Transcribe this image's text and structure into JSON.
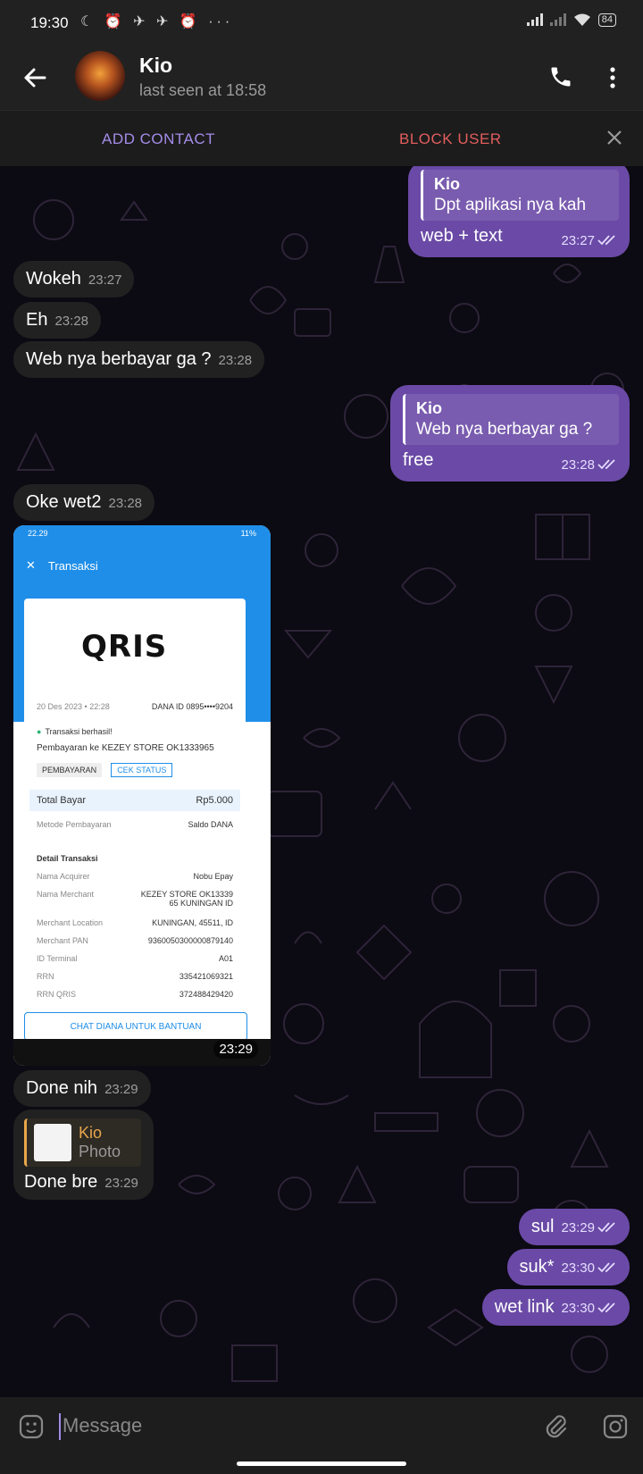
{
  "status_bar": {
    "time": "19:30",
    "icons": "☾ ⏰ ✈ ✈ ⏰ ···",
    "battery": "84"
  },
  "header": {
    "name": "Kio",
    "status": "last seen at 18:58"
  },
  "contact_bar": {
    "add_label": "ADD CONTACT",
    "block_label": "BLOCK USER"
  },
  "messages": [
    {
      "dir": "out",
      "reply_name": "Kio",
      "reply_text": "Dpt aplikasi nya kah",
      "text": "web + text",
      "time": "23:27"
    },
    {
      "dir": "in",
      "text": "Wokeh",
      "time": "23:27"
    },
    {
      "dir": "in",
      "text": "Eh",
      "time": "23:28"
    },
    {
      "dir": "in",
      "text": "Web nya berbayar ga ?",
      "time": "23:28"
    },
    {
      "dir": "out",
      "reply_name": "Kio",
      "reply_text": "Web nya berbayar ga ?",
      "text": "free",
      "time": "23:28"
    },
    {
      "dir": "in",
      "text": "Oke wet2",
      "time": "23:28"
    },
    {
      "dir": "in",
      "text": "Done nih",
      "time": "23:29"
    },
    {
      "dir": "in",
      "reply_name": "Kio",
      "reply_text": "Photo",
      "text": "Done bre",
      "time": "23:29"
    },
    {
      "dir": "out",
      "text": "sul",
      "time": "23:29"
    },
    {
      "dir": "out",
      "text": "suk*",
      "time": "23:30"
    },
    {
      "dir": "out",
      "text": "wet link",
      "time": "23:30"
    }
  ],
  "photo": {
    "time": "23:29",
    "status_time": "22.29",
    "battery": "11%",
    "title": "Transaksi",
    "logo": "QRIS",
    "date": "20 Des 2023 • 22:28",
    "dana_id": "DANA ID 0895••••9204",
    "success": "Transaksi berhasil!",
    "payment_to": "Pembayaran ke KEZEY STORE OK1333965",
    "tag": "PEMBAYARAN",
    "check_status": "CEK STATUS",
    "total_label": "Total Bayar",
    "total_value": "Rp5.000",
    "method_label": "Metode Pembayaran",
    "method_value": "Saldo DANA",
    "details_title": "Detail Transaksi",
    "details": [
      {
        "k": "Nama Acquirer",
        "v": "Nobu Epay"
      },
      {
        "k": "Nama Merchant",
        "v": "KEZEY STORE OK13339 65 KUNINGAN ID"
      },
      {
        "k": "Merchant Location",
        "v": "KUNINGAN, 45511, ID"
      },
      {
        "k": "Merchant PAN",
        "v": "9360050300000879140"
      },
      {
        "k": "ID Terminal",
        "v": "A01"
      },
      {
        "k": "RRN",
        "v": "335421069321"
      },
      {
        "k": "RRN QRIS",
        "v": "372488429420"
      }
    ],
    "help_button": "CHAT DIANA UNTUK BANTUAN"
  },
  "input": {
    "placeholder": "Message"
  },
  "colors": {
    "outgoing": "#6a4aa6",
    "incoming": "#212121",
    "accent": "#a38ce8",
    "danger": "#e25d5d"
  }
}
